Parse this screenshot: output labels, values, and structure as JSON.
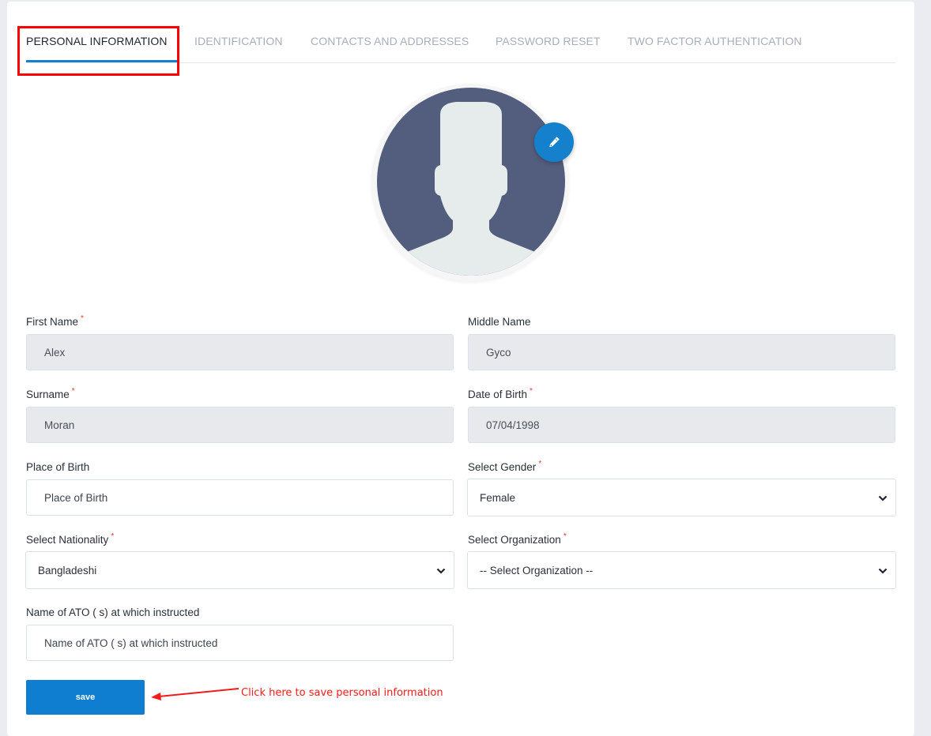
{
  "tabs": [
    {
      "label": "PERSONAL INFORMATION",
      "active": true
    },
    {
      "label": "IDENTIFICATION",
      "active": false
    },
    {
      "label": "CONTACTS AND ADDRESSES",
      "active": false
    },
    {
      "label": "PASSWORD RESET",
      "active": false
    },
    {
      "label": "TWO FACTOR AUTHENTICATION",
      "active": false
    }
  ],
  "avatar": {
    "icon": "person-silhouette-icon",
    "edit_icon": "pencil-icon"
  },
  "form": {
    "first_name": {
      "label": "First Name",
      "required": "*",
      "value": "Alex"
    },
    "middle_name": {
      "label": "Middle Name",
      "value": "Gyco"
    },
    "surname": {
      "label": "Surname",
      "required": "*",
      "value": "Moran"
    },
    "date_of_birth": {
      "label": "Date of Birth",
      "required": "*",
      "value": "07/04/1998"
    },
    "place_of_birth": {
      "label": "Place of Birth",
      "placeholder": "Place of Birth",
      "value": ""
    },
    "gender": {
      "label": "Select Gender",
      "required": "*",
      "selected": "Female"
    },
    "nationality": {
      "label": "Select Nationality",
      "required": "*",
      "selected": "Bangladeshi"
    },
    "organization": {
      "label": "Select Organization",
      "required": "*",
      "selected": "-- Select Organization --"
    },
    "ato": {
      "label": "Name of ATO ( s) at which instructed",
      "placeholder": "Name of ATO ( s) at which instructed",
      "value": ""
    }
  },
  "save_label": "save",
  "annotation": {
    "text": "Click here to save personal information",
    "color": "#ff0000"
  },
  "colors": {
    "accent": "#1580cc",
    "avatar_bg": "#535e7e",
    "disabled_input": "#e7e9ec"
  }
}
